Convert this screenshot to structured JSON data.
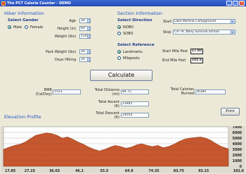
{
  "window": {
    "title": "The PCT Calorie Counter - DEMO"
  },
  "hiker": {
    "heading": "Hiker Information",
    "gender": {
      "label": "Select Gender",
      "options": [
        "Male",
        "Female"
      ],
      "selected": "Male"
    },
    "age": {
      "label": "Age",
      "value": "30"
    },
    "height": {
      "label": "Height (in)",
      "value": "60"
    },
    "weight": {
      "label": "Weight (lbs)",
      "value": "150"
    },
    "pack_weight": {
      "label": "Pack Weight (lbs)",
      "value": "30"
    },
    "days_hiking": {
      "label": "Days Hiking",
      "value": "10"
    }
  },
  "section": {
    "heading": "Section Information",
    "direction": {
      "label": "Select Direction",
      "options": [
        "NOBO",
        "SOBO"
      ],
      "selected": "NOBO"
    },
    "reference": {
      "label": "Select Reference",
      "options": [
        "Landmarks",
        "Mileposts"
      ],
      "selected": "Landmarks"
    },
    "start": {
      "label": "Start",
      "value": "Lake Morena Campground"
    },
    "stop": {
      "label": "Stop",
      "value": "CA-79, Navy Survival School"
    },
    "start_mile": {
      "label": "Start Mile Post",
      "value": "17.85"
    },
    "end_mile": {
      "label": "End Mile Post",
      "value": "102.6"
    }
  },
  "calculate_label": "Calculate",
  "results": {
    "bmr": {
      "label_line1": "BMR",
      "label_line2": "(Cal/Day)",
      "value": "1553"
    },
    "distance": {
      "label_line1": "Total Distance",
      "label_line2": "(mi)",
      "value": "84.75"
    },
    "ascent": {
      "label_line1": "Total Ascent",
      "label_line2": "(ft)",
      "value": "23945"
    },
    "descent": {
      "label_line1": "Total Descent",
      "label_line2": "(ft)",
      "value": "24054"
    },
    "calories": {
      "label_line1": "Total Calories",
      "label_line2": "Burned",
      "value": "26385"
    }
  },
  "profile": {
    "title": "Elevation Profile",
    "print_label": "Print",
    "fill_color": "#c7572e",
    "grid_color": "#555555",
    "y_ticks": [
      "7000",
      "6000",
      "5000",
      "4000",
      "3000",
      "2000",
      "1000",
      "0"
    ],
    "x_ticks": [
      "17.85",
      "27.25",
      "36.65",
      "46.1",
      "55.5",
      "64.9",
      "74.35",
      "83.75",
      "93.15",
      "102.6"
    ]
  },
  "chart_data": {
    "type": "area",
    "title": "Elevation Profile",
    "xlabel": "",
    "ylabel": "",
    "xlim": [
      17.85,
      102.6
    ],
    "ylim": [
      0,
      7000
    ],
    "grid": true,
    "x": [
      17.85,
      20,
      22,
      24,
      26,
      28,
      30,
      32,
      34,
      36,
      38,
      40,
      42,
      44,
      46,
      48,
      50,
      52,
      54,
      56,
      58,
      60,
      62,
      64,
      66,
      68,
      70,
      72,
      74,
      76,
      78,
      80,
      82,
      84,
      86,
      88,
      90,
      92,
      94,
      96,
      98,
      100,
      102.6
    ],
    "y": [
      3000,
      3400,
      3700,
      3900,
      4300,
      4900,
      5500,
      5700,
      5900,
      5800,
      5500,
      5000,
      5200,
      4800,
      4300,
      3900,
      3400,
      3000,
      2700,
      3000,
      3400,
      3700,
      3500,
      3200,
      3400,
      3800,
      4000,
      3700,
      3500,
      3700,
      3300,
      3500,
      3900,
      4400,
      4800,
      5000,
      5100,
      5200,
      5000,
      4600,
      4000,
      3500,
      3100
    ]
  }
}
